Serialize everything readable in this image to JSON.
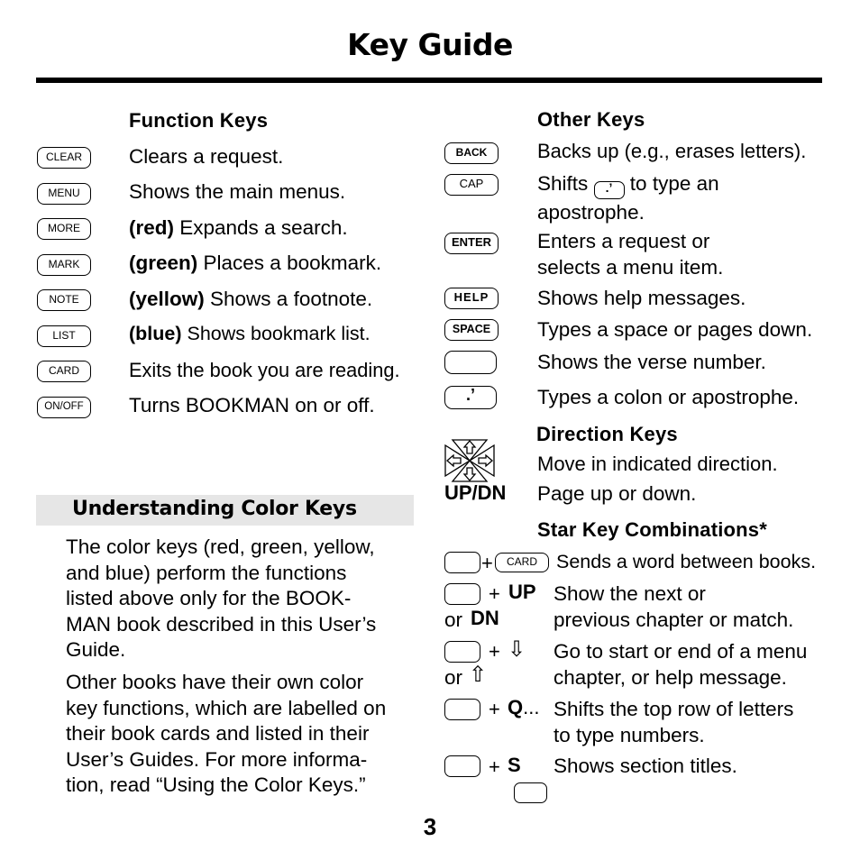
{
  "page": {
    "title": "Key Guide",
    "page_number": "3"
  },
  "function_keys": {
    "heading": "Function Keys",
    "items": [
      {
        "key": "CLEAR",
        "prefix": "",
        "text": "Clears a request."
      },
      {
        "key": "MENU",
        "prefix": "",
        "text": "Shows the main menus."
      },
      {
        "key": "MORE",
        "prefix": "(red)",
        "text": " Expands a search."
      },
      {
        "key": "MARK",
        "prefix": "(green)",
        "text": " Places a bookmark."
      },
      {
        "key": "NOTE",
        "prefix": "(yellow)",
        "text": " Shows a footnote."
      },
      {
        "key": "LIST",
        "prefix": "(blue)",
        "text": " Shows bookmark list."
      },
      {
        "key": "CARD",
        "prefix": "",
        "text": "Exits the book you are reading."
      },
      {
        "key": "ON/OFF",
        "prefix": "",
        "text": "Turns BOOKMAN on or off."
      }
    ]
  },
  "color_keys": {
    "heading": "Understanding Color Keys",
    "para1": [
      "The color keys (red, green, yellow,",
      "and blue) perform the functions",
      "listed above only for the BOOK-",
      "MAN book described in this User’s",
      "Guide."
    ],
    "para2": [
      "Other books have their own color",
      "key functions, which are labelled on",
      "their book cards and listed in their",
      "User’s Guides. For more informa-",
      "tion, read “Using the Color Keys.”"
    ]
  },
  "other_keys": {
    "heading": "Other Keys",
    "items": [
      {
        "key": "BACK",
        "lines": [
          "Backs up (e.g., erases letters)."
        ]
      },
      {
        "key": "CAP",
        "lines": [
          "Shifts",
          " to type an",
          "apostrophe."
        ],
        "inline_key": ".’"
      },
      {
        "key": "ENTER",
        "lines": [
          "Enters a request or",
          "selects a menu item."
        ]
      },
      {
        "key": "HELP",
        "lines": [
          "Shows help messages."
        ]
      },
      {
        "key": "SPACE",
        "lines": [
          "Types a space or pages down."
        ]
      },
      {
        "key": "",
        "lines": [
          "Shows the verse number."
        ]
      },
      {
        "key": ".’",
        "lines": [
          "Types a colon or apostrophe."
        ]
      }
    ]
  },
  "direction_keys": {
    "heading": "Direction Keys",
    "dpad_text": "Move in indicated direction.",
    "updn_label": "UP/DN",
    "updn_text": "Page up or down."
  },
  "star_keys": {
    "heading": "Star Key Combinations*",
    "items": [
      {
        "combo": "+ CARD",
        "key2": "CARD",
        "lines": [
          "Sends a word between books."
        ]
      },
      {
        "combo_plus": "+",
        "combo_key": "UP",
        "alt_or": "or",
        "alt_key": "DN",
        "lines": [
          "Show the next or",
          "previous chapter or match."
        ]
      },
      {
        "combo_plus": "+",
        "combo_key": "⇩",
        "alt_or": "or",
        "alt_key": "⇧",
        "lines": [
          "Go to start or end of a menu",
          "chapter, or help message."
        ]
      },
      {
        "combo_plus": "+",
        "combo_key": "Q",
        "combo_suffix": "...",
        "lines": [
          "Shifts the top row of letters",
          "to type numbers."
        ]
      },
      {
        "combo_plus": "+",
        "combo_key": "S",
        "lines": [
          "Shows section titles."
        ]
      }
    ]
  }
}
